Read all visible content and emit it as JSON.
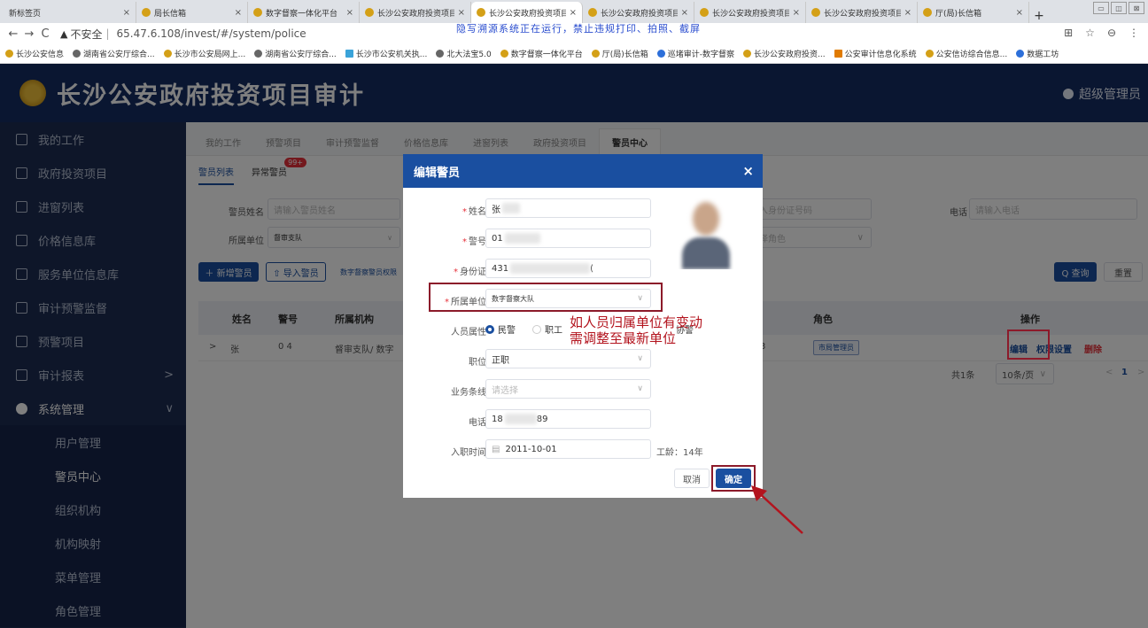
{
  "browser": {
    "tabs": [
      {
        "label": "新标签页"
      },
      {
        "label": "局长信箱"
      },
      {
        "label": "数字督察一体化平台"
      },
      {
        "label": "长沙公安政府投资项目"
      },
      {
        "label": "长沙公安政府投资项目"
      },
      {
        "label": "长沙公安政府投资项目"
      },
      {
        "label": "长沙公安政府投资项目"
      },
      {
        "label": "长沙公安政府投资项目"
      },
      {
        "label": "厅(局)长信箱"
      }
    ],
    "new_tab": "+",
    "win_buttons": [
      "▭",
      "◫",
      "⊠"
    ],
    "nav": {
      "back": "←",
      "forward": "→",
      "reload": "C"
    },
    "insecure_label": "不安全",
    "url": "65.47.6.108/invest/#/system/police",
    "banner": "隐写溯源系统正在运行，禁止违规打印、拍照、截屏",
    "right_icons": [
      "⊞",
      "☆",
      "⊖",
      "⋮"
    ],
    "bookmarks": [
      {
        "label": "长沙公安信息",
        "icon": "badge"
      },
      {
        "label": "湖南省公安厅综合...",
        "icon": "globe"
      },
      {
        "label": "长沙市公安局网上...",
        "icon": "badge"
      },
      {
        "label": "湖南省公安厅综合...",
        "icon": "globe"
      },
      {
        "label": "长沙市公安机关执...",
        "icon": "map"
      },
      {
        "label": "北大法宝5.0",
        "icon": "globe"
      },
      {
        "label": "数字督察一体化平台",
        "icon": "badge"
      },
      {
        "label": "厅(局)长信箱",
        "icon": "badge"
      },
      {
        "label": "巡堵审计-数字督察",
        "icon": "shield"
      },
      {
        "label": "长沙公安政府投资...",
        "icon": "badge"
      },
      {
        "label": "公安审计信息化系统",
        "icon": "tmr"
      },
      {
        "label": "公安信访综合信息...",
        "icon": "badge"
      },
      {
        "label": "数据工坊",
        "icon": "globe"
      }
    ]
  },
  "app": {
    "title": "长沙公安政府投资项目审计",
    "user": "超级管理员"
  },
  "sidebar": {
    "items": [
      {
        "label": "我的工作"
      },
      {
        "label": "政府投资项目"
      },
      {
        "label": "进窗列表"
      },
      {
        "label": "价格信息库"
      },
      {
        "label": "服务单位信息库"
      },
      {
        "label": "审计预警监督"
      },
      {
        "label": "预警项目"
      },
      {
        "label": "审计报表",
        "arrow": ">"
      }
    ],
    "group": {
      "label": "系统管理",
      "arrow": "∨"
    },
    "sub_items": [
      {
        "label": "用户管理"
      },
      {
        "label": "警员中心",
        "active": true
      },
      {
        "label": "组织机构"
      },
      {
        "label": "机构映射"
      },
      {
        "label": "菜单管理"
      },
      {
        "label": "角色管理"
      }
    ]
  },
  "main": {
    "tabs": [
      "我的工作",
      "预警项目",
      "审计预警监督",
      "价格信息库",
      "进窗列表",
      "政府投资项目",
      "警员中心"
    ],
    "sub_tabs": [
      "警员列表",
      "异常警员"
    ],
    "badge": "99+",
    "filters": {
      "name_label": "警员姓名",
      "name_placeholder": "请输入警员姓名",
      "unit_label": "所属单位",
      "unit_value": "督审支队",
      "id_placeholder": "入身份证号码",
      "role_placeholder": "择角色",
      "phone_label": "电话",
      "phone_placeholder": "请输入电话"
    },
    "buttons": {
      "add": "＋ 新增警员",
      "import": "⇧ 导入警员",
      "link": "数字督察警员权限",
      "query": "Q 查询",
      "reset": "重置"
    },
    "table": {
      "headers": {
        "name": "姓名",
        "badge_no": "警号",
        "org": "所属机构",
        "role": "角色",
        "ops": "操作"
      },
      "row": {
        "expand": ">",
        "name": "张",
        "badge_no": "0   4",
        "org": "督审支队/ 数字",
        "col4": "3",
        "role": "市局管理员",
        "edit": "编辑",
        "perm": "权限设置",
        "del": "删除"
      }
    },
    "pager": {
      "total": "共1条",
      "size": "10条/页",
      "prev": "<",
      "page": "1",
      "next": ">"
    }
  },
  "dialog": {
    "title": "编辑警员",
    "close": "×",
    "fields": {
      "name_label": "姓名",
      "name_value": "张",
      "badge_label": "警号",
      "badge_value": "01",
      "id_label": "身份证",
      "id_value": "431",
      "id_suffix": "(",
      "unit_label": "所属单位",
      "unit_value": "数字督察大队",
      "attr_label": "人员属性",
      "attr_opt1": "民警",
      "attr_opt2": "职工",
      "attr_opt3": "协警",
      "post_label": "职位",
      "post_value": "正职",
      "line_label": "业务条线",
      "line_placeholder": "请选择",
      "phone_label": "电话",
      "phone_value": "18",
      "phone_suffix": "89",
      "date_label": "入职时间",
      "date_value": "2011-10-01",
      "seniority": "工龄：14年"
    },
    "cancel": "取消",
    "ok": "确定"
  },
  "annotation": {
    "line1": "如人员归属单位有变动",
    "line2": "需调整至最新单位"
  },
  "colors": {
    "primary": "#1a4fa0",
    "sidebar": "#1d2d52",
    "header": "#152d63",
    "highlight": "#8c1a2a",
    "annotation": "#b3141e"
  }
}
